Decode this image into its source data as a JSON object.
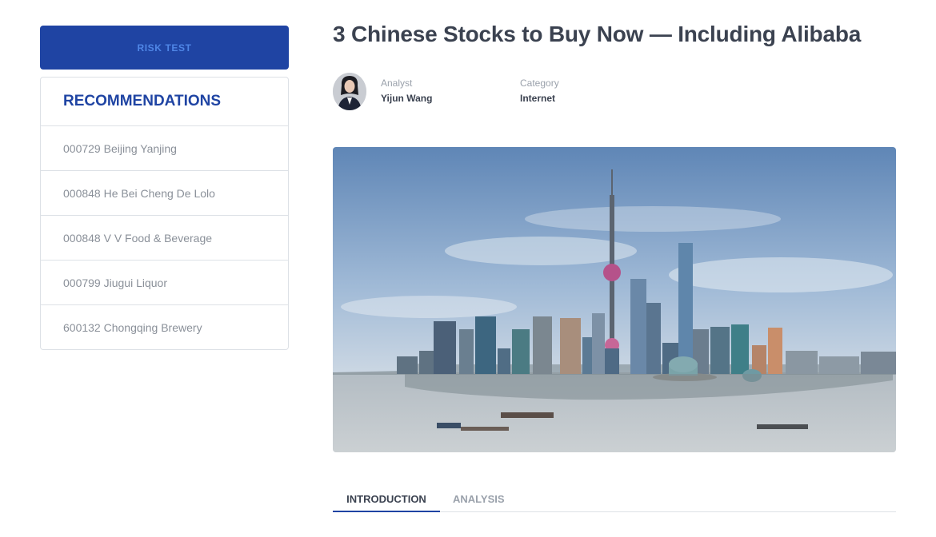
{
  "sidebar": {
    "risk_button_label": "RISK TEST",
    "recommendations_title": "RECOMMENDATIONS",
    "items": [
      {
        "label": "000729 Beijing Yanjing"
      },
      {
        "label": "000848 He Bei Cheng De Lolo"
      },
      {
        "label": "000848 V V Food & Beverage"
      },
      {
        "label": "000799 Jiugui Liquor"
      },
      {
        "label": "600132 Chongqing Brewery"
      }
    ]
  },
  "article": {
    "title": "3 Chinese Stocks to Buy Now — Including Alibaba",
    "analyst_label": "Analyst",
    "analyst_name": "Yijun Wang",
    "category_label": "Category",
    "category_value": "Internet"
  },
  "tabs": [
    {
      "label": "INTRODUCTION",
      "active": true
    },
    {
      "label": "ANALYSIS",
      "active": false
    }
  ],
  "colors": {
    "primary": "#1f44a3",
    "primary_text": "#4f86e6",
    "muted": "#8a9099",
    "border": "#dde1e6"
  },
  "icons": {
    "avatar": "analyst-avatar",
    "hero": "shanghai-skyline-image"
  }
}
